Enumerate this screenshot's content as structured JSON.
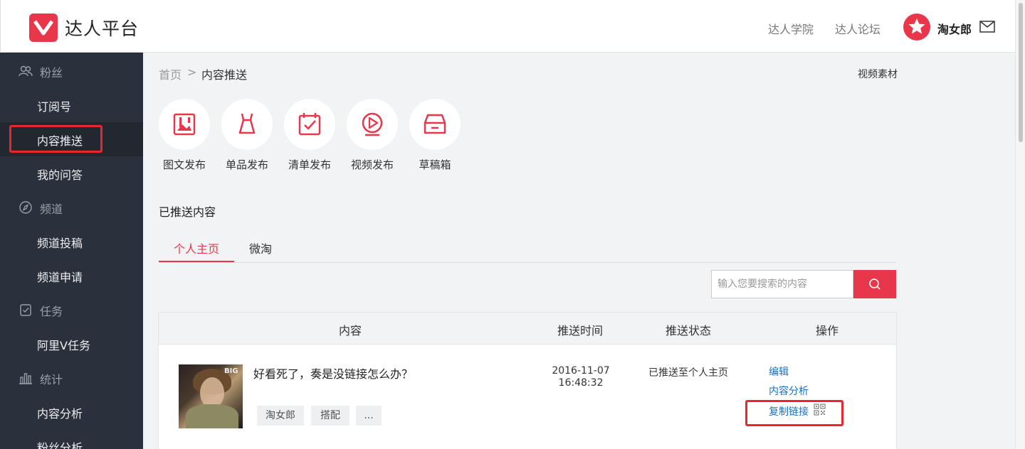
{
  "header": {
    "brand": "达人平台",
    "links": [
      "达人学院",
      "达人论坛"
    ],
    "username": "淘女郎"
  },
  "sidebar": {
    "items": [
      {
        "label": "粉丝",
        "type": "group",
        "icon": "fans-icon"
      },
      {
        "label": "订阅号",
        "type": "item"
      },
      {
        "label": "内容推送",
        "type": "item",
        "active": true
      },
      {
        "label": "我的问答",
        "type": "item"
      },
      {
        "label": "频道",
        "type": "group",
        "icon": "compass-icon"
      },
      {
        "label": "频道投稿",
        "type": "item"
      },
      {
        "label": "频道申请",
        "type": "item"
      },
      {
        "label": "任务",
        "type": "group",
        "icon": "clipboard-check-icon"
      },
      {
        "label": "阿里V任务",
        "type": "item"
      },
      {
        "label": "统计",
        "type": "group",
        "icon": "bar-chart-icon"
      },
      {
        "label": "内容分析",
        "type": "item"
      },
      {
        "label": "粉丝分析",
        "type": "item"
      }
    ]
  },
  "breadcrumb": {
    "home": "首页",
    "separator": ">",
    "current": "内容推送"
  },
  "video_material": "视频素材",
  "publish": [
    {
      "label": "图文发布",
      "icon": "image-text-icon"
    },
    {
      "label": "单品发布",
      "icon": "dress-icon"
    },
    {
      "label": "清单发布",
      "icon": "checklist-icon"
    },
    {
      "label": "视频发布",
      "icon": "play-video-icon"
    },
    {
      "label": "草稿箱",
      "icon": "drafts-tray-icon"
    }
  ],
  "section_title": "已推送内容",
  "tabs": [
    {
      "label": "个人主页",
      "active": true
    },
    {
      "label": "微淘",
      "active": false
    }
  ],
  "search": {
    "placeholder": "输入您要搜索的内容",
    "value": ""
  },
  "table": {
    "headers": [
      "内容",
      "推送时间",
      "推送状态",
      "操作"
    ],
    "rows": [
      {
        "title": "好看死了，奏是没链接怎么办？",
        "tags": [
          "淘女郎",
          "搭配",
          "..."
        ],
        "date": "2016-11-07",
        "time": "16:48:32",
        "status": "已推送至个人主页",
        "actions": [
          "编辑",
          "内容分析",
          "复制链接"
        ],
        "thumb_text": "BIG"
      }
    ]
  },
  "colors": {
    "accent": "#e8374a",
    "link": "#1a6fc0",
    "sidebar_bg": "#2b313c",
    "highlight": "#e8262f"
  }
}
